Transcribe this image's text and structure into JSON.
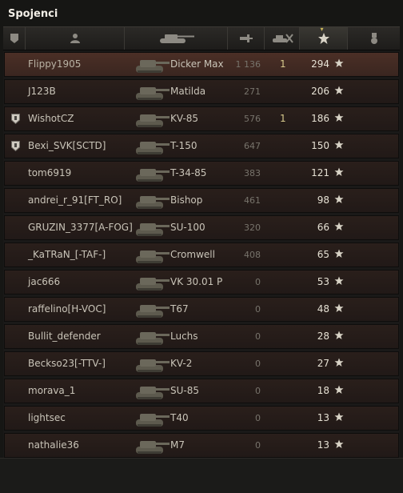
{
  "team_title": "Spojenci",
  "columns": {
    "icons": [
      "squad-icon",
      "player-icon",
      "tank-icon",
      "damage-icon",
      "kills-icon",
      "experience-star-icon",
      "medal-icon"
    ],
    "sorted_by": "experience"
  },
  "players": [
    {
      "name": "Flippy1905",
      "tank": "Dicker Max",
      "damage": "1 136",
      "kills": "1",
      "xp": "294",
      "rank_badge": false,
      "self": true
    },
    {
      "name": "J123B",
      "tank": "Matilda",
      "damage": "271",
      "kills": "",
      "xp": "206",
      "rank_badge": false,
      "self": false
    },
    {
      "name": "WishotCZ",
      "tank": "KV-85",
      "damage": "576",
      "kills": "1",
      "xp": "186",
      "rank_badge": true,
      "self": false
    },
    {
      "name": "Bexi_SVK[SCTD]",
      "tank": "T-150",
      "damage": "647",
      "kills": "",
      "xp": "150",
      "rank_badge": true,
      "self": false
    },
    {
      "name": "tom6919",
      "tank": "T-34-85",
      "damage": "383",
      "kills": "",
      "xp": "121",
      "rank_badge": false,
      "self": false
    },
    {
      "name": "andrei_r_91[FT_RO]",
      "tank": "Bishop",
      "damage": "461",
      "kills": "",
      "xp": "98",
      "rank_badge": false,
      "self": false
    },
    {
      "name": "GRUZIN_3377[A-FOG]",
      "tank": "SU-100",
      "damage": "320",
      "kills": "",
      "xp": "66",
      "rank_badge": false,
      "self": false
    },
    {
      "name": "_KaTRaN_[-TAF-]",
      "tank": "Cromwell",
      "damage": "408",
      "kills": "",
      "xp": "65",
      "rank_badge": false,
      "self": false
    },
    {
      "name": "jac666",
      "tank": "VK 30.01 P",
      "damage": "0",
      "kills": "",
      "xp": "53",
      "rank_badge": false,
      "self": false
    },
    {
      "name": "raffelino[H-VOC]",
      "tank": "T67",
      "damage": "0",
      "kills": "",
      "xp": "48",
      "rank_badge": false,
      "self": false
    },
    {
      "name": "Bullit_defender",
      "tank": "Luchs",
      "damage": "0",
      "kills": "",
      "xp": "28",
      "rank_badge": false,
      "self": false
    },
    {
      "name": "Beckso23[-TTV-]",
      "tank": "KV-2",
      "damage": "0",
      "kills": "",
      "xp": "27",
      "rank_badge": false,
      "self": false
    },
    {
      "name": "morava_1",
      "tank": "SU-85",
      "damage": "0",
      "kills": "",
      "xp": "18",
      "rank_badge": false,
      "self": false
    },
    {
      "name": "lightsec",
      "tank": "T40",
      "damage": "0",
      "kills": "",
      "xp": "13",
      "rank_badge": false,
      "self": false
    },
    {
      "name": "nathalie36",
      "tank": "M7",
      "damage": "0",
      "kills": "",
      "xp": "13",
      "rank_badge": false,
      "self": false
    }
  ],
  "colors": {
    "self_row": "#4b2f26",
    "row": "#2a1f1b",
    "xp_text": "#e6e1d4",
    "kills_text": "#d6c98c",
    "damage_text": "#77736b"
  }
}
